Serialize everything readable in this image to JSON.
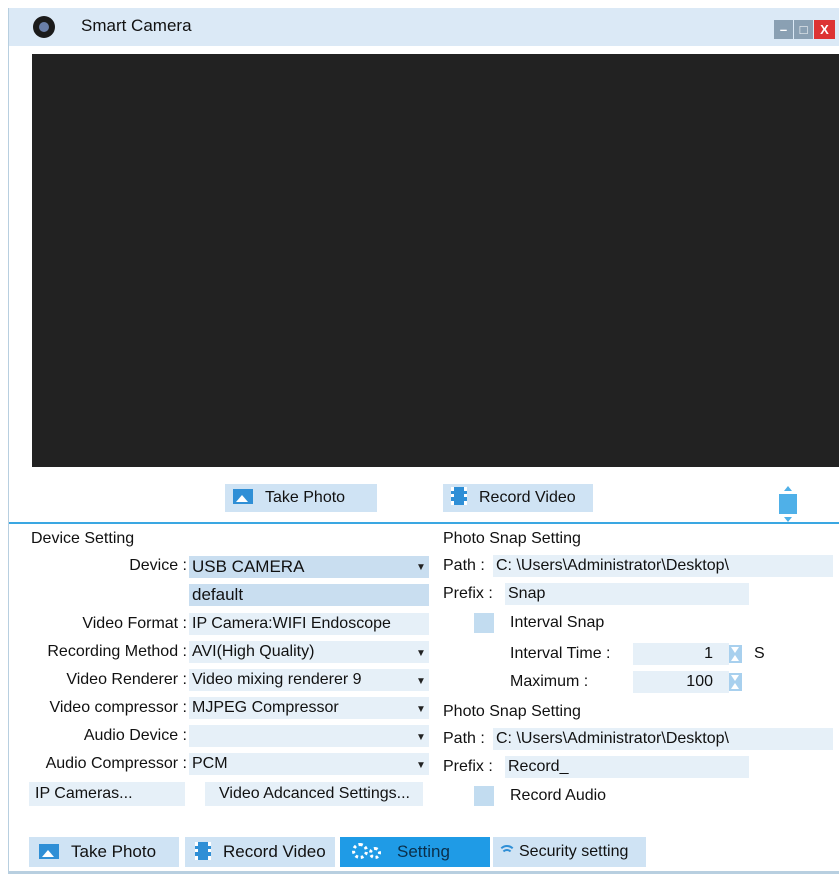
{
  "window": {
    "title": "Smart Camera",
    "controls": {
      "minimize": "–",
      "maximize": "□",
      "close": "X"
    }
  },
  "toolbar": {
    "take_photo": "Take Photo",
    "record_video": "Record Video"
  },
  "device_setting": {
    "heading": "Device Setting",
    "device_label": "Device :",
    "device_value": "USB CAMERA",
    "device_mode": "default",
    "video_format_label": "Video Format :",
    "video_format_value": "IP Camera:WIFI Endoscope",
    "recording_method_label": "Recording Method :",
    "recording_method_value": "AVI(High Quality)",
    "video_renderer_label": "Video Renderer :",
    "video_renderer_value": "Video mixing renderer 9",
    "video_compressor_label": "Video compressor :",
    "video_compressor_value": "MJPEG Compressor",
    "audio_device_label": "Audio Device :",
    "audio_device_value": "",
    "audio_compressor_label": "Audio Compressor :",
    "audio_compressor_value": "PCM",
    "ip_cameras_button": "IP Cameras...",
    "video_advanced_button": "Video Adcanced Settings..."
  },
  "photo_snap": {
    "heading": "Photo Snap Setting",
    "path_label": "Path :",
    "path_value": "C: \\Users\\Administrator\\Desktop\\",
    "prefix_label": "Prefix :",
    "prefix_value": "Snap",
    "interval_snap_label": "Interval Snap",
    "interval_time_label": "Interval Time :",
    "interval_time_value": "1",
    "interval_time_unit": "S",
    "maximum_label": "Maximum :",
    "maximum_value": "100"
  },
  "video_snap": {
    "heading": "Photo Snap Setting",
    "path_label": "Path :",
    "path_value": "C: \\Users\\Administrator\\Desktop\\",
    "prefix_label": "Prefix :",
    "prefix_value": "Record_",
    "record_audio_label": "Record Audio"
  },
  "tabs": {
    "take_photo": "Take Photo",
    "record_video": "Record Video",
    "setting": "Setting",
    "security": "Security setting"
  },
  "colors": {
    "accent": "#1f9be6",
    "titlebar": "#dbe9f6",
    "preview_bg": "#222222",
    "button_bg": "#cfe3f4"
  }
}
